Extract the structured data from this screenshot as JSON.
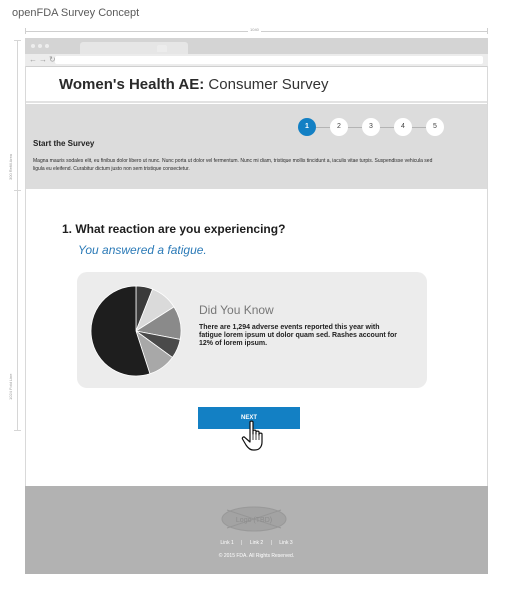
{
  "concept_title": "openFDA Survey Concept",
  "dimensions": {
    "top_label": "1040",
    "left_upper_label": "300 Refill Area",
    "left_lower_label": "1024 Fold Line"
  },
  "header": {
    "title_bold": "Women's Health AE:",
    "title_rest": " Consumer Survey"
  },
  "steps": [
    "1",
    "2",
    "3",
    "4",
    "5"
  ],
  "active_step": 1,
  "banner": {
    "heading": "Start the Survey",
    "body": "Magna mauris sodales elit, eu finibus dolor libero ut nunc. Nunc porta ut dolor vel fermentum. Nunc mi diam, tristique mollis tincidunt a, iaculis vitae turpis. Suspendisse vehicula sed ligula eu eleifend. Curabitur dictum justo non sem tristique consectetur."
  },
  "question": {
    "text": "1. What reaction are you experiencing?",
    "answer": "You answered a fatigue."
  },
  "did_you_know": {
    "title": "Did You Know",
    "text": "There are 1,294 adverse events reported this year with fatigue lorem ipsum ut dolor quam sed. Rashes account for 12% of lorem ipsum."
  },
  "chart_data": {
    "type": "pie",
    "values": [
      6,
      10,
      12,
      7,
      10,
      55
    ],
    "colors": [
      "#3a3a3a",
      "#dadada",
      "#8a8a8a",
      "#4a4a4a",
      "#a8a8a8",
      "#1e1e1e"
    ]
  },
  "next_button": {
    "label": "NEXT"
  },
  "footer": {
    "logo": "Logo (TBD)",
    "links": [
      "Link 1",
      "Link 2",
      "Link 3"
    ],
    "separator": "|",
    "copyright": "© 2015 FDA. All Rights Reserved."
  },
  "colors": {
    "accent": "#1380c4",
    "answer": "#2b7ab7",
    "banner_bg": "#dcdcdc",
    "footer_bg": "#b2b2b2"
  }
}
